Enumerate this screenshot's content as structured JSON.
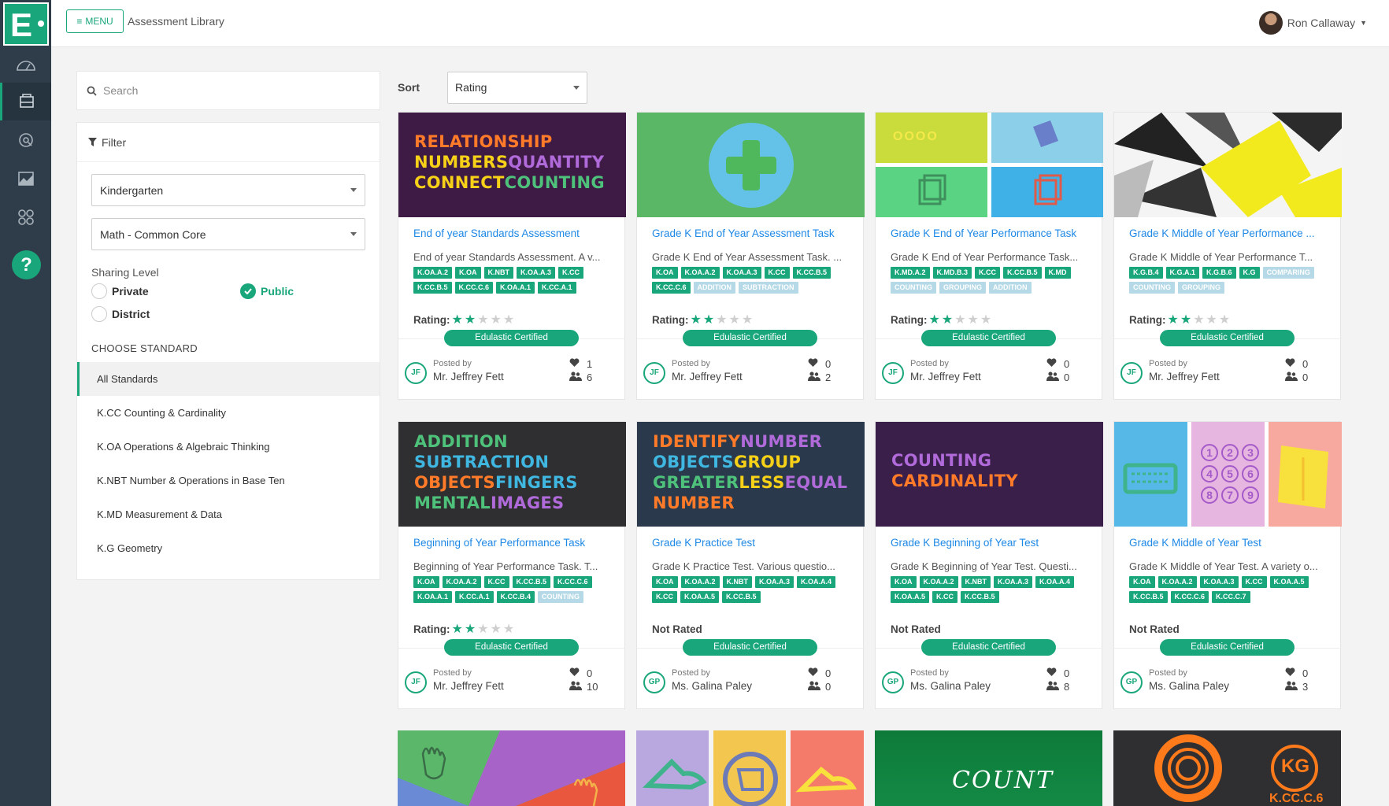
{
  "app": {
    "title": "Assessment Library",
    "menu_label": "MENU",
    "user_name": "Ron Callaway"
  },
  "rail": {
    "icons": [
      "dashboard-icon",
      "library-icon",
      "search-icon",
      "reports-icon",
      "apps-icon"
    ],
    "help_label": "?"
  },
  "sidebar": {
    "search_placeholder": "Search",
    "filter_label": "Filter",
    "grade": "Kindergarten",
    "subject": "Math - Common Core",
    "sharing_level_label": "Sharing Level",
    "sharing": [
      {
        "label": "Private",
        "selected": false
      },
      {
        "label": "Public",
        "selected": true
      },
      {
        "label": "District",
        "selected": false
      }
    ],
    "choose_standard_label": "CHOOSE STANDARD",
    "standards": [
      "All Standards",
      "K.CC Counting & Cardinality",
      "K.OA Operations & Algebraic Thinking",
      "K.NBT Number & Operations in Base Ten",
      "K.MD Measurement & Data",
      "K.G Geometry"
    ]
  },
  "sort": {
    "label": "Sort",
    "value": "Rating"
  },
  "colors": {
    "accent": "#19a67a",
    "link": "#1e88e5",
    "rail": "#2f3d4a"
  },
  "common": {
    "posted_by": "Posted by",
    "certified": "Edulastic Certified",
    "rating_label": "Rating:",
    "not_rated": "Not Rated"
  },
  "cards": [
    {
      "title": "End of year Standards Assessment",
      "desc": "End of year Standards Assessment. A v...",
      "tags": [
        "K.OA.A.2",
        "K.OA",
        "K.NBT",
        "K.OA.A.3",
        "K.CC",
        "K.CC.B.5",
        "K.CC.C.6",
        "K.OA.A.1",
        "K.CC.A.1"
      ],
      "gtags": [],
      "rated": true,
      "stars": 2,
      "initials": "JF",
      "author": "Mr. Jeffrey Fett",
      "likes": "1",
      "shares": "6",
      "thumb_words": [
        [
          "RELATIONSHIP",
          "#ff7a29"
        ],
        [
          "NUMBERS",
          "#f7d118"
        ],
        [
          "QUANTITY",
          "#b06ad9"
        ],
        [
          "CONNECT",
          "#f7d118"
        ],
        [
          "COUNTING",
          "#4ec27a"
        ]
      ]
    },
    {
      "title": "Grade K End of Year Assessment Task",
      "desc": "Grade K End of Year Assessment Task. ...",
      "tags": [
        "K.OA",
        "K.OA.A.2",
        "K.OA.A.3",
        "K.CC",
        "K.CC.B.5",
        "K.CC.C.6"
      ],
      "gtags": [
        "ADDITION",
        "SUBTRACTION"
      ],
      "rated": true,
      "stars": 2,
      "initials": "JF",
      "author": "Mr. Jeffrey Fett",
      "likes": "0",
      "shares": "2"
    },
    {
      "title": "Grade K End of Year Performance Task",
      "desc": "Grade K End of Year Performance Task...",
      "tags": [
        "K.MD.A.2",
        "K.MD.B.3",
        "K.CC",
        "K.CC.B.5",
        "K.MD"
      ],
      "gtags": [
        "COUNTING",
        "GROUPING",
        "ADDITION"
      ],
      "rated": true,
      "stars": 2,
      "initials": "JF",
      "author": "Mr. Jeffrey Fett",
      "likes": "0",
      "shares": "0",
      "thumb_word": "OOOO"
    },
    {
      "title": "Grade K Middle of Year Performance ...",
      "desc": "Grade K Middle of Year Performance T...",
      "tags": [
        "K.G.B.4",
        "K.G.A.1",
        "K.G.B.6",
        "K.G"
      ],
      "gtags": [
        "COMPARING",
        "COUNTING",
        "GROUPING"
      ],
      "rated": true,
      "stars": 2,
      "initials": "JF",
      "author": "Mr. Jeffrey Fett",
      "likes": "0",
      "shares": "0"
    },
    {
      "title": "Beginning of Year Performance Task",
      "desc": "Beginning of Year Performance Task. T...",
      "tags": [
        "K.OA",
        "K.OA.A.2",
        "K.CC",
        "K.CC.B.5",
        "K.CC.C.6",
        "K.OA.A.1",
        "K.CC.A.1",
        "K.CC.B.4"
      ],
      "gtags": [
        "COUNTING"
      ],
      "rated": true,
      "stars": 2,
      "initials": "JF",
      "author": "Mr. Jeffrey Fett",
      "likes": "0",
      "shares": "10",
      "thumb_words": [
        [
          "ADDITION",
          "#4ec27a"
        ],
        [
          "SUBTRACTION",
          "#3fb7e0"
        ],
        [
          "OBJECTS",
          "#ff7a29"
        ],
        [
          "FINGERS",
          "#3fb7e0"
        ],
        [
          "MENTAL",
          "#4ec27a"
        ],
        [
          "IMAGES",
          "#b06ad9"
        ]
      ]
    },
    {
      "title": "Grade K Practice Test",
      "desc": "Grade K Practice Test.  Various questio...",
      "tags": [
        "K.OA",
        "K.OA.A.2",
        "K.NBT",
        "K.OA.A.3",
        "K.OA.A.4",
        "K.CC",
        "K.OA.A.5",
        "K.CC.B.5"
      ],
      "gtags": [],
      "rated": false,
      "stars": 0,
      "initials": "GP",
      "author": "Ms. Galina Paley",
      "likes": "0",
      "shares": "0",
      "thumb_words": [
        [
          "IDENTIFY",
          "#ff7a29"
        ],
        [
          "NUMBER",
          "#b06ad9"
        ],
        [
          "OBJECTS",
          "#3fb7e0"
        ],
        [
          "GROUP",
          "#f7d118"
        ],
        [
          "GREATER",
          "#4ec27a"
        ],
        [
          "LESS",
          "#f7d118"
        ],
        [
          "EQUAL",
          "#b06ad9"
        ],
        [
          "NUMBER",
          "#ff7a29"
        ]
      ]
    },
    {
      "title": "Grade K Beginning of Year Test",
      "desc": "Grade K Beginning of Year Test. Questi...",
      "tags": [
        "K.OA",
        "K.OA.A.2",
        "K.NBT",
        "K.OA.A.3",
        "K.OA.A.4",
        "K.OA.A.5",
        "K.CC",
        "K.CC.B.5"
      ],
      "gtags": [],
      "rated": false,
      "stars": 0,
      "initials": "GP",
      "author": "Ms. Galina Paley",
      "likes": "0",
      "shares": "8",
      "thumb_words": [
        [
          "COUNTING",
          "#b06ad9"
        ],
        [
          "CARDINALITY",
          "#ff7a29"
        ]
      ]
    },
    {
      "title": "Grade K Middle of Year Test",
      "desc": "Grade K Middle of Year Test. A variety o...",
      "tags": [
        "K.OA",
        "K.OA.A.2",
        "K.OA.A.3",
        "K.CC",
        "K.OA.A.5",
        "K.CC.B.5",
        "K.CC.C.6",
        "K.CC.C.7"
      ],
      "gtags": [],
      "rated": false,
      "stars": 0,
      "initials": "GP",
      "author": "Ms. Galina Paley",
      "likes": "0",
      "shares": "3",
      "thumb_digits": [
        "1",
        "2",
        "3",
        "4",
        "5",
        "6",
        "8",
        "7",
        "9"
      ]
    }
  ],
  "row3": {
    "count_word": "COUNT",
    "kg_label": "KG",
    "kg_code": "K.CC.C.6"
  }
}
